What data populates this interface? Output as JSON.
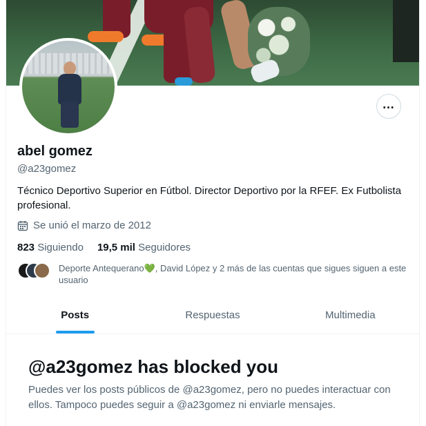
{
  "profile": {
    "name": "abel gomez",
    "handle": "@a23gomez",
    "bio": "Técnico Deportivo Superior en Fútbol. Director Deportivo por la RFEF. Ex Futbolista profesional.",
    "joined": "Se unió el marzo de 2012",
    "following_count": "823",
    "following_label": "Siguiendo",
    "followers_count": "19,5 mil",
    "followers_label": "Seguidores",
    "mutual_text": "Deporte Antequerano💚, David López y 2 más de las cuentas que sigues siguen a este usuario",
    "more_icon": "more-options-icon",
    "calendar_icon": "calendar-icon"
  },
  "tabs": [
    {
      "label": "Posts",
      "active": true
    },
    {
      "label": "Respuestas",
      "active": false
    },
    {
      "label": "Multimedia",
      "active": false
    }
  ],
  "blocked": {
    "title": "@a23gomez has blocked you",
    "message": "Puedes ver los posts públicos de @a23gomez, pero no puedes interactuar con ellos. Tampoco puedes seguir a @a23gomez ni enviarle mensajes."
  },
  "colors": {
    "accent": "#1d9bf0",
    "text_primary": "#0f1419",
    "text_secondary": "#536471"
  }
}
